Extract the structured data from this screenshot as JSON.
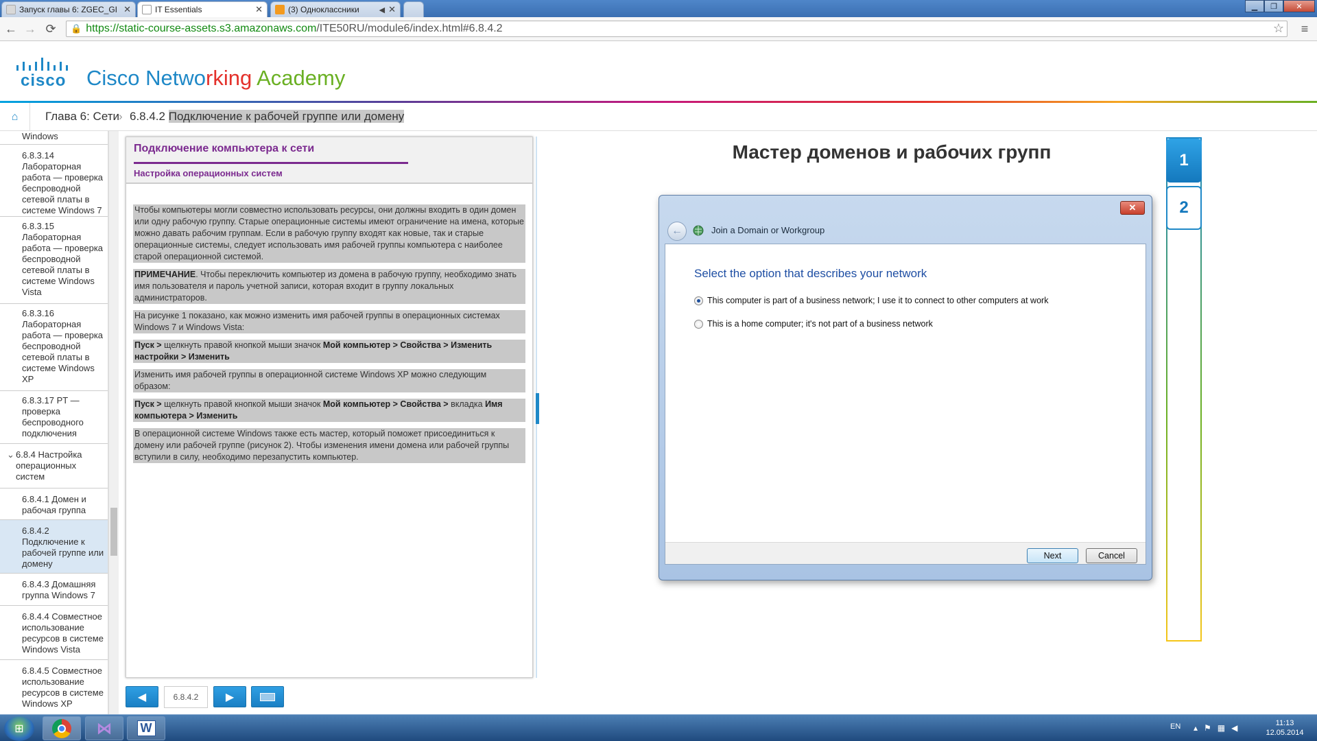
{
  "browser": {
    "tabs": [
      {
        "title": "Запуск главы 6: ZGEC_GI",
        "icon": "google-doc-icon"
      },
      {
        "title": "IT Essentials",
        "icon": "page-icon"
      },
      {
        "title": "(3) Одноклассники",
        "icon": "ok-icon"
      }
    ],
    "url_host": "https://static-course-assets.s3.amazonaws.com",
    "url_path": "/ITE50RU/module6/index.html#6.8.4.2"
  },
  "header": {
    "logo_word": "cisco",
    "title_parts": [
      "Cisco Netwo",
      "rking",
      " Academy"
    ],
    "accent": "#1e88c7"
  },
  "breadcrumb": {
    "chapter": "Глава 6: Сети",
    "section_num": "6.8.4.2",
    "section_title": "Подключение к рабочей группе или домену"
  },
  "sidebar": {
    "items": [
      {
        "text": "Windows"
      },
      {
        "text": "6.8.3.14 Лабораторная работа — проверка беспроводной сетевой платы в системе Windows 7"
      },
      {
        "text": "6.8.3.15 Лабораторная работа — проверка беспроводной сетевой платы в системе Windows Vista"
      },
      {
        "text": "6.8.3.16 Лабораторная работа — проверка беспроводной сетевой платы в системе Windows XP"
      },
      {
        "text": "6.8.3.17 PT — проверка беспроводного подключения"
      },
      {
        "text": "6.8.4 Настройка операционных систем"
      },
      {
        "text": "6.8.4.1 Домен и рабочая группа"
      },
      {
        "text": "6.8.4.2 Подключение к рабочей группе или домену"
      },
      {
        "text": "6.8.4.3 Домашняя группа Windows 7"
      },
      {
        "text": "6.8.4.4 Совместное использование ресурсов в системе Windows Vista"
      },
      {
        "text": "6.8.4.5 Совместное использование ресурсов в системе Windows XP"
      }
    ]
  },
  "panel": {
    "title": "Подключение компьютера к сети",
    "subtitle": "Настройка операционных систем",
    "p1": "Чтобы компьютеры могли совместно использовать ресурсы, они должны входить в один домен или одну рабочую группу. Старые операционные системы имеют ограничение на имена, которые можно давать рабочим группам. Если в рабочую группу входят как новые, так и старые операционные системы, следует использовать имя рабочей группы компьютера с наиболее старой операционной системой.",
    "p2_bold": "ПРИМЕЧАНИЕ",
    "p2": ". Чтобы переключить компьютер из домена в рабочую группу, необходимо знать имя пользователя и пароль учетной записи, которая входит в группу локальных администраторов.",
    "p3": "На рисунке 1 показано, как можно изменить имя рабочей группы в операционных системах Windows 7 и Windows Vista:",
    "p4_a": "Пуск >",
    "p4_b": " щелкнуть правой кнопкой мыши значок ",
    "p4_c": "Мой компьютер > Свойства > Изменить настройки > Изменить",
    "p5": "Изменить имя рабочей группы в операционной системе Windows XP можно следующим образом:",
    "p6_a": "Пуск >",
    "p6_b": " щелкнуть правой кнопкой мыши значок ",
    "p6_c": "Мой компьютер > Свойства >",
    "p6_d": " вкладка ",
    "p6_e": "Имя компьютера > Изменить",
    "p7": "В операционной системе Windows также есть мастер, который поможет присоединиться к домену или рабочей группе (рисунок 2). Чтобы изменения имени домена или рабочей группы вступили в силу, необходимо перезапустить компьютер."
  },
  "pager": {
    "page": "6.8.4.2"
  },
  "slide": {
    "title": "Мастер доменов и рабочих групп",
    "steps": [
      "1",
      "2"
    ],
    "wizard": {
      "window_title": "Join a Domain or Workgroup",
      "heading": "Select the option that describes your network",
      "options": [
        {
          "label": "This computer is part of a business network; I use it to connect to other computers at work",
          "selected": true
        },
        {
          "label": "This is a home computer; it's not part of a business network",
          "selected": false
        }
      ],
      "next_label": "Next",
      "cancel_label": "Cancel"
    }
  },
  "taskbar": {
    "lang": "EN",
    "time": "11:13",
    "date": "12.05.2014"
  }
}
